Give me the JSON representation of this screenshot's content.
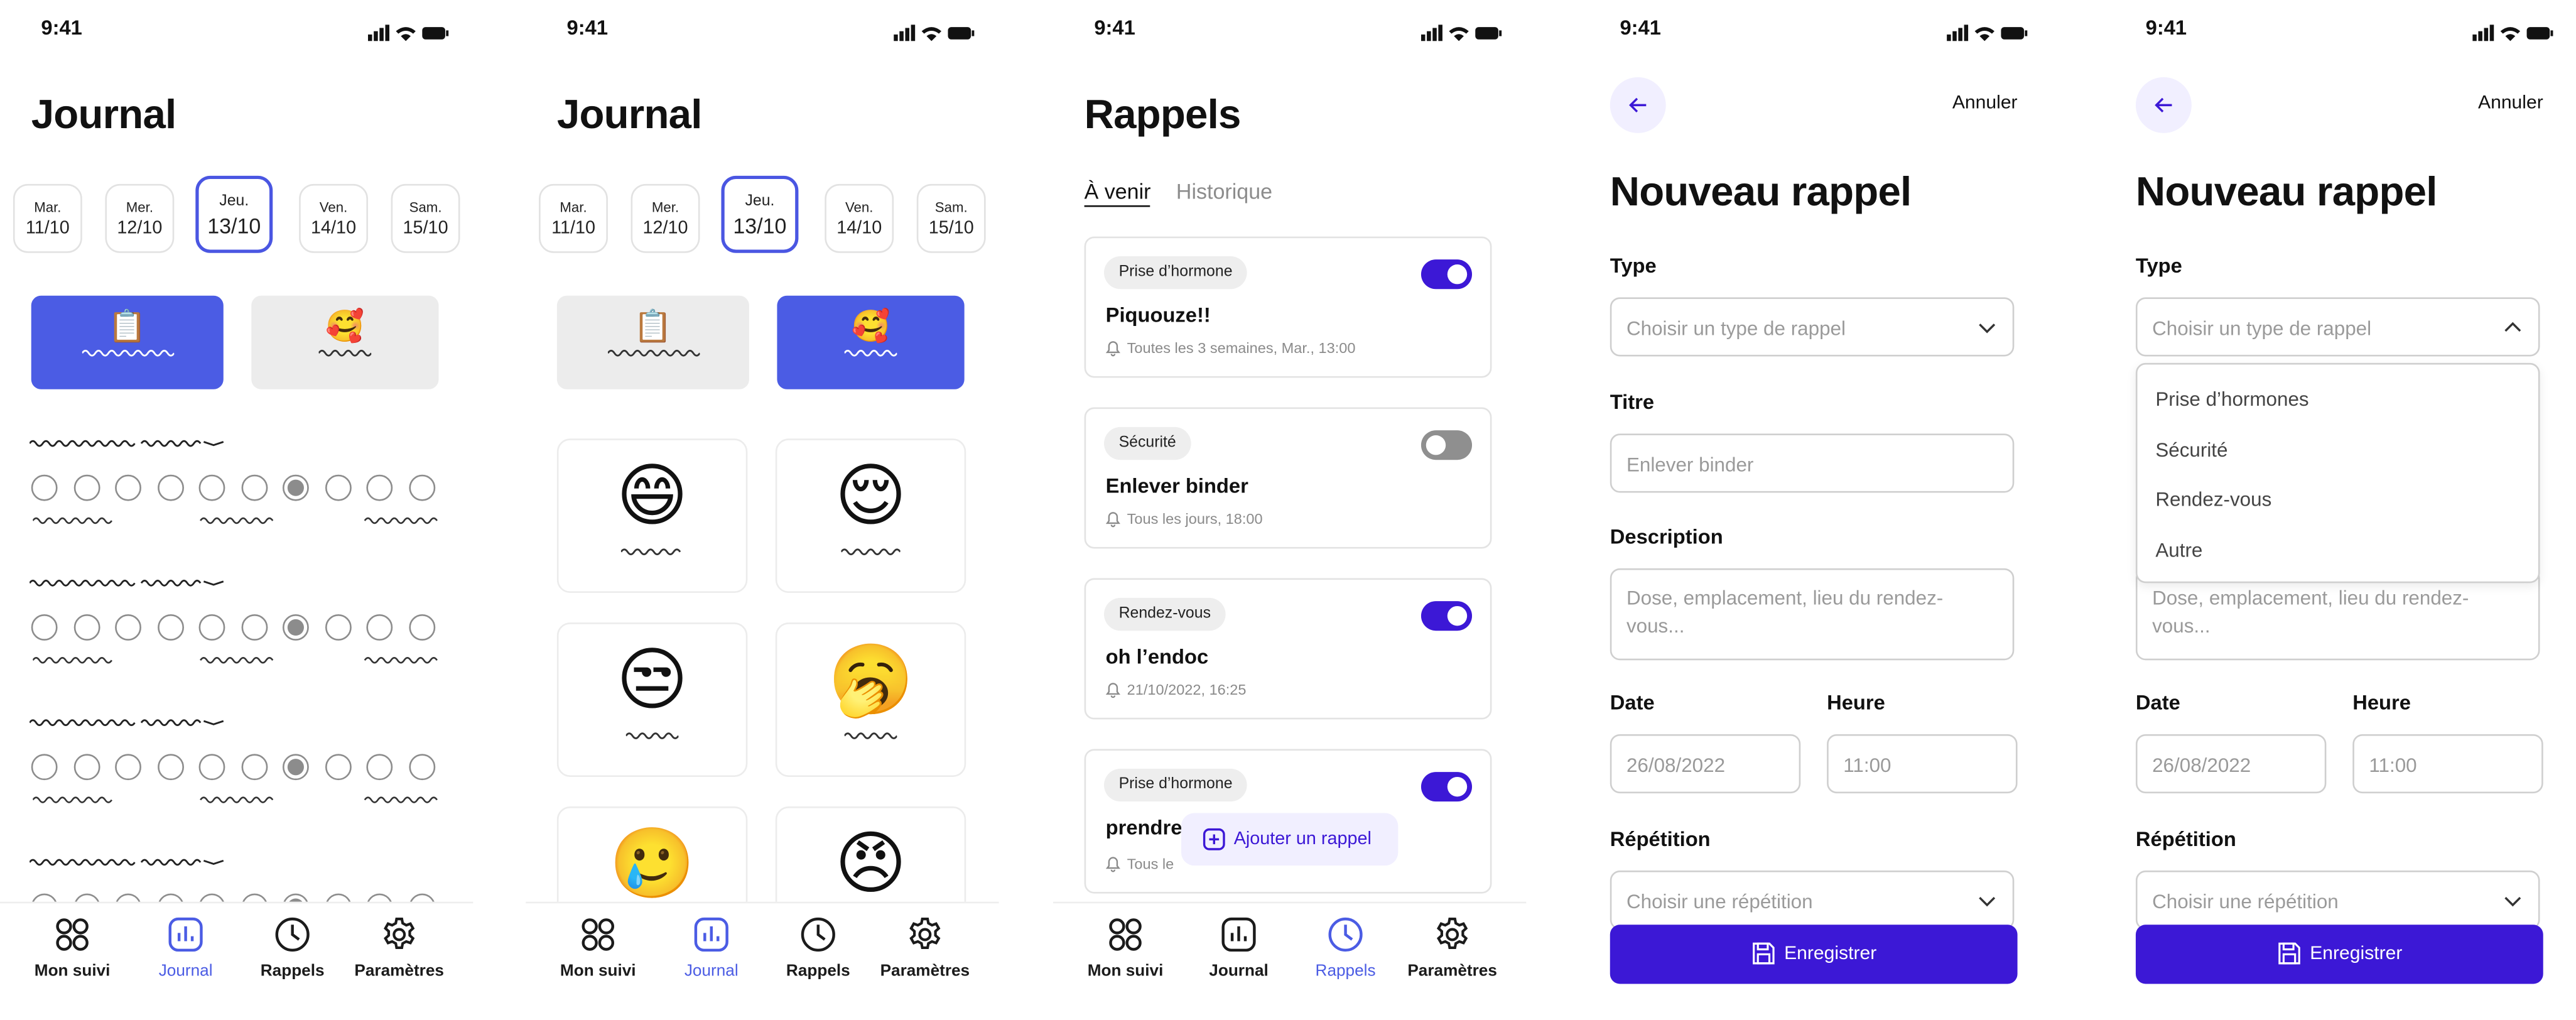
{
  "status": {
    "time": "9:41"
  },
  "journal": {
    "title": "Journal",
    "days": [
      {
        "name": "Mar.",
        "date": "11/10"
      },
      {
        "name": "Mer.",
        "date": "12/10"
      },
      {
        "name": "Jeu.",
        "date": "13/10"
      },
      {
        "name": "Ven.",
        "date": "14/10"
      },
      {
        "name": "Sam.",
        "date": "15/10"
      }
    ],
    "selected_day": "13/10",
    "modes": [
      {
        "icon": "clipboard-icon",
        "glyph": "📋"
      },
      {
        "icon": "blush-heart-face-icon",
        "glyph": "🥰"
      }
    ],
    "scale_selected_index": 6,
    "moods": [
      {
        "icon": "grinning-face-icon",
        "glyph": "😄"
      },
      {
        "icon": "relieved-face-icon",
        "glyph": "😌"
      },
      {
        "icon": "unamused-face-icon",
        "glyph": "😒"
      },
      {
        "icon": "yawning-face-icon",
        "glyph": "🥱"
      },
      {
        "icon": "sad-tear-face-icon",
        "glyph": "🥲"
      },
      {
        "icon": "angry-face-icon",
        "glyph": "😠"
      }
    ]
  },
  "nav": {
    "items": [
      {
        "label": "Mon suivi",
        "icon": "grid-icon"
      },
      {
        "label": "Journal",
        "icon": "chart-icon"
      },
      {
        "label": "Rappels",
        "icon": "clock-icon"
      },
      {
        "label": "Paramètres",
        "icon": "gear-icon"
      }
    ]
  },
  "rappels": {
    "title": "Rappels",
    "tabs": [
      "À venir",
      "Historique"
    ],
    "items": [
      {
        "badge": "Prise d’hormone",
        "title": "Piquouze!!",
        "schedule": "Toutes les 3 semaines, Mar., 13:00",
        "enabled": true
      },
      {
        "badge": "Sécurité",
        "title": "Enlever binder",
        "schedule": "Tous les jours, 18:00",
        "enabled": false
      },
      {
        "badge": "Rendez-vous",
        "title": "oh l’endoc",
        "schedule": "21/10/2022, 16:25",
        "enabled": true
      },
      {
        "badge": "Prise d’hormone",
        "title": "prendre",
        "schedule": "Tous le",
        "enabled": true
      }
    ],
    "add_button": "Ajouter un rappel"
  },
  "form": {
    "cancel": "Annuler",
    "title": "Nouveau rappel",
    "type_label": "Type",
    "type_placeholder": "Choisir un type de rappel",
    "titre_label": "Titre",
    "titre_placeholder": "Enlever binder",
    "description_label": "Description",
    "description_placeholder": "Dose, emplacement, lieu du rendez-vous...",
    "date_label": "Date",
    "date_placeholder": "26/08/2022",
    "heure_label": "Heure",
    "heure_placeholder": "11:00",
    "repetition_label": "Répétition",
    "repetition_placeholder": "Choisir une répétition",
    "save": "Enregistrer",
    "type_options": [
      "Prise d’hormones",
      "Sécurité",
      "Rendez-vous",
      "Autre"
    ]
  },
  "colors": {
    "accent": "#3c18d6",
    "journal_accent": "#4b5ce4"
  }
}
